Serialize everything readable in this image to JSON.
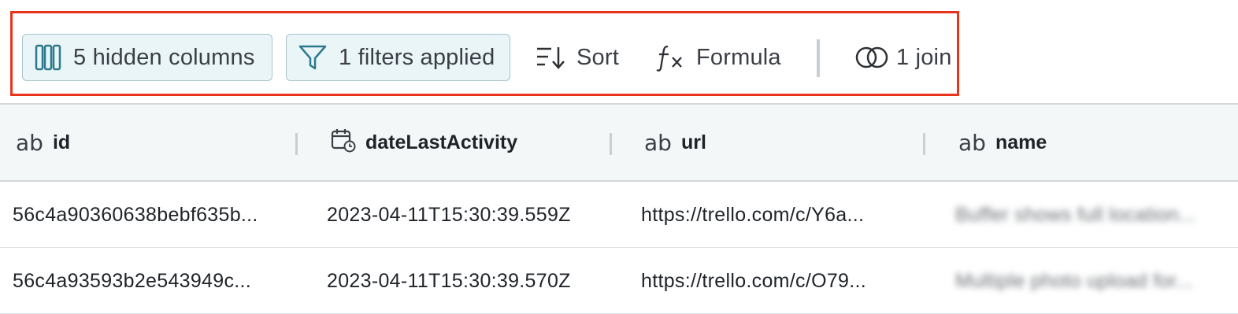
{
  "toolbar": {
    "hidden_columns": "5 hidden columns",
    "filters": "1 filters applied",
    "sort": "Sort",
    "formula": "Formula",
    "joins": "1 join"
  },
  "columns": [
    {
      "type_icon": "ab",
      "name": "id"
    },
    {
      "type_icon": "calendar-clock-icon",
      "name": "dateLastActivity"
    },
    {
      "type_icon": "ab",
      "name": "url"
    },
    {
      "type_icon": "ab",
      "name": "name"
    }
  ],
  "rows": [
    [
      "56c4a90360638bebf635b...",
      "2023-04-11T15:30:39.559Z",
      "https://trello.com/c/Y6a...",
      "Buffer shows full location..."
    ],
    [
      "56c4a93593b2e543949c...",
      "2023-04-11T15:30:39.570Z",
      "https://trello.com/c/O79...",
      "Multiple photo upload for..."
    ]
  ],
  "colors": {
    "highlight": "#e8341c",
    "chip_bg": "#eaf5f8",
    "header_bg": "#f3f7f8"
  }
}
